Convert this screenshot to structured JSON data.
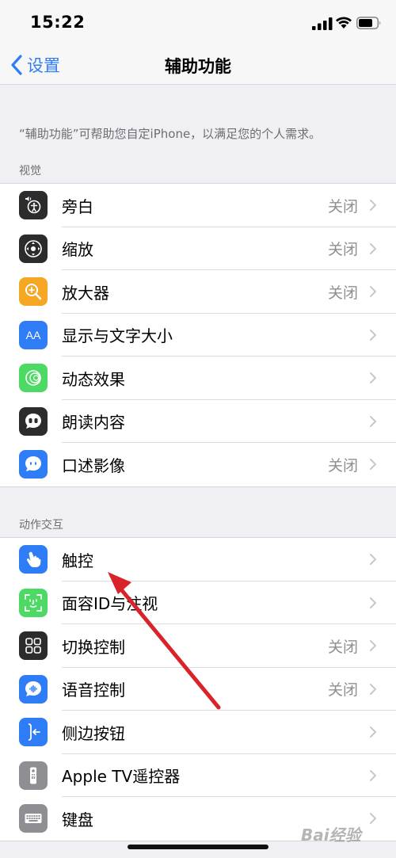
{
  "status_bar": {
    "time": "15:22"
  },
  "nav": {
    "back_label": "设置",
    "title": "辅助功能"
  },
  "description": "“辅助功能”可帮助您自定iPhone，以满足您的个人需求。",
  "sections": [
    {
      "header": "视觉",
      "items": [
        {
          "label": "旁白",
          "value": "关闭",
          "icon": "voiceover-icon",
          "color": "#2c2c2e"
        },
        {
          "label": "缩放",
          "value": "关闭",
          "icon": "zoom-icon",
          "color": "#2c2c2e"
        },
        {
          "label": "放大器",
          "value": "关闭",
          "icon": "magnifier-icon",
          "color": "#f5a623"
        },
        {
          "label": "显示与文字大小",
          "value": "",
          "icon": "text-size-icon",
          "color": "#2f7df6"
        },
        {
          "label": "动态效果",
          "value": "",
          "icon": "motion-icon",
          "color": "#4cd964"
        },
        {
          "label": "朗读内容",
          "value": "",
          "icon": "spoken-content-icon",
          "color": "#2c2c2e"
        },
        {
          "label": "口述影像",
          "value": "关闭",
          "icon": "audio-description-icon",
          "color": "#2f7df6"
        }
      ]
    },
    {
      "header": "动作交互",
      "items": [
        {
          "label": "触控",
          "value": "",
          "icon": "touch-icon",
          "color": "#2f7df6"
        },
        {
          "label": "面容ID与注视",
          "value": "",
          "icon": "face-id-icon",
          "color": "#4cd964"
        },
        {
          "label": "切换控制",
          "value": "关闭",
          "icon": "switch-control-icon",
          "color": "#2c2c2e"
        },
        {
          "label": "语音控制",
          "value": "关闭",
          "icon": "voice-control-icon",
          "color": "#2f7df6"
        },
        {
          "label": "侧边按钮",
          "value": "",
          "icon": "side-button-icon",
          "color": "#2f7df6"
        },
        {
          "label": "Apple TV遥控器",
          "value": "",
          "icon": "apple-tv-remote-icon",
          "color": "#8e8e93"
        },
        {
          "label": "键盘",
          "value": "",
          "icon": "keyboard-icon",
          "color": "#8e8e93"
        }
      ]
    }
  ],
  "watermark": "Bai经验",
  "colors": {
    "accent": "#2f7df6",
    "annotation_arrow": "#d9232a",
    "background": "#efeff4"
  }
}
